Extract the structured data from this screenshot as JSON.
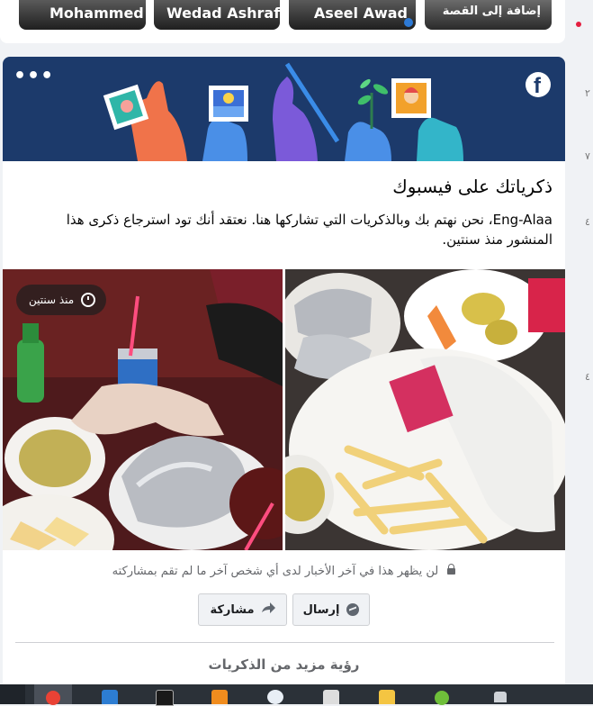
{
  "stories": [
    {
      "name": "Mohammed"
    },
    {
      "name": "Wedad Ashraf"
    },
    {
      "name": "Aseel Awad"
    },
    {
      "name": "إضافة إلى القصة"
    }
  ],
  "edge_numbers": [
    "٢",
    "٧",
    "٤",
    "٤"
  ],
  "memory": {
    "title": "ذكرياتك على فيسبوك",
    "message": "Eng-Alaa، نحن نهتم بك وبالذكريات التي تشاركها هنا. نعتقد أنك تود استرجاع ذكرى هذا المنشور منذ سنتين.",
    "time_badge": "منذ سنتين",
    "privacy_note": "لن يظهر هذا في آخر الأخبار لدى أي شخص آخر ما لم تقم بمشاركته",
    "send_label": "إرسال",
    "share_label": "مشاركة",
    "see_more_label": "رؤية مزيد من الذكريات"
  },
  "icons": {
    "more": "more-icon",
    "facebook": "facebook-logo-icon",
    "clock": "clock-icon",
    "lock": "lock-icon",
    "messenger": "messenger-icon",
    "share": "share-arrow-icon"
  },
  "colors": {
    "banner": "#1c3a6b",
    "facebook_blue": "#1877f2",
    "muted_text": "#65676b",
    "button_bg": "#f0f2f5"
  }
}
